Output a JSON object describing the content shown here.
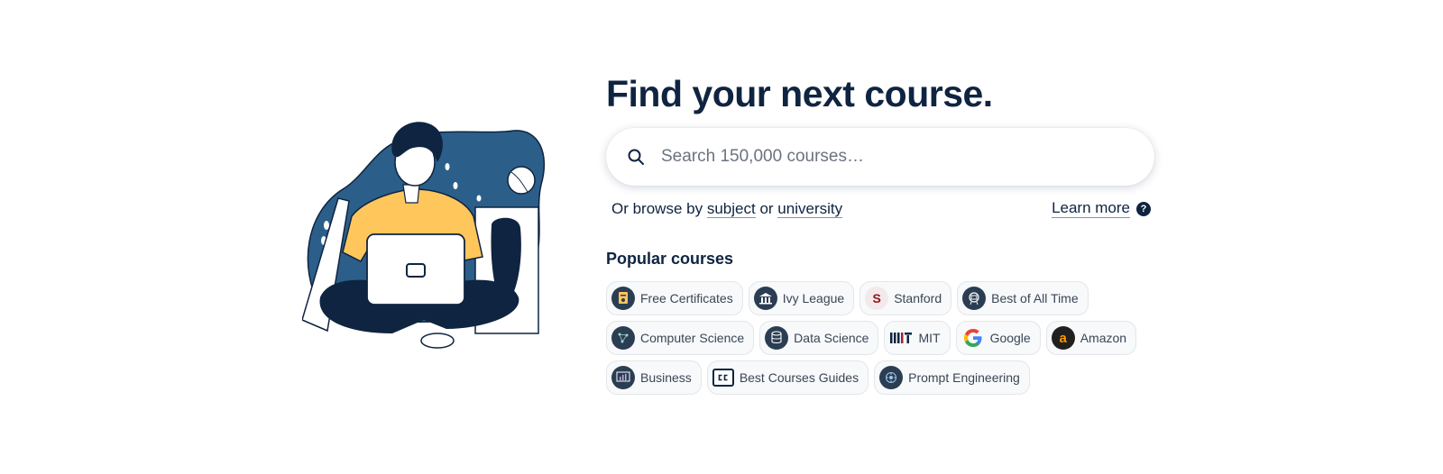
{
  "hero": {
    "title": "Find your next course."
  },
  "search": {
    "placeholder": "Search 150,000 courses…"
  },
  "browse": {
    "prefix": "Or browse by",
    "subject_link": "subject",
    "connector": "or",
    "university_link": "university",
    "learn_more": "Learn more",
    "help_glyph": "?"
  },
  "popular": {
    "title": "Popular courses",
    "chips": [
      {
        "label": "Free Certificates",
        "icon": "certificate-icon"
      },
      {
        "label": "Ivy League",
        "icon": "university-building-icon"
      },
      {
        "label": "Stanford",
        "icon": "stanford-logo-icon"
      },
      {
        "label": "Best of All Time",
        "icon": "award-badge-icon"
      },
      {
        "label": "Computer Science",
        "icon": "circuit-icon"
      },
      {
        "label": "Data Science",
        "icon": "database-icon"
      },
      {
        "label": "MIT",
        "icon": "mit-logo-icon"
      },
      {
        "label": "Google",
        "icon": "google-logo-icon"
      },
      {
        "label": "Amazon",
        "icon": "amazon-logo-icon"
      },
      {
        "label": "Business",
        "icon": "chart-board-icon"
      },
      {
        "label": "Best Courses Guides",
        "icon": "cc-logo-icon"
      },
      {
        "label": "Prompt Engineering",
        "icon": "ai-brain-icon"
      }
    ]
  },
  "colors": {
    "text": "#0f2440",
    "accent_blue": "#2b5f8a",
    "accent_yellow": "#ffc65c",
    "chip_bg": "#f7f9fa"
  }
}
